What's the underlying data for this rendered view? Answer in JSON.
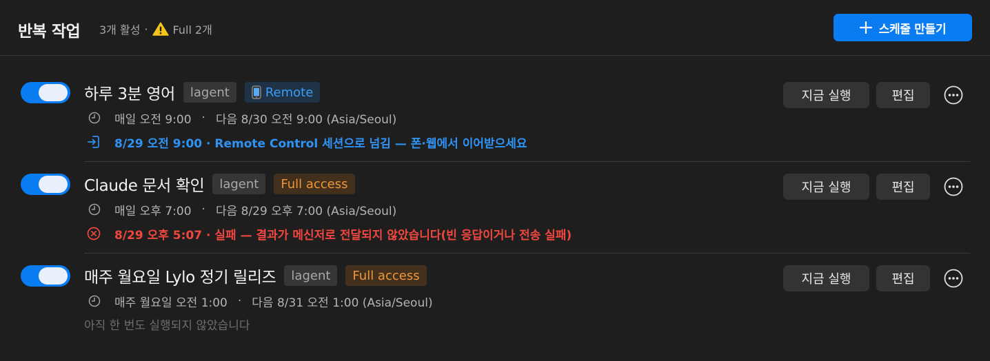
{
  "header": {
    "title": "반복 작업",
    "active_count": "3개 활성",
    "dot": "·",
    "full_count": "Full 2개",
    "create_button": "스케줄 만들기"
  },
  "colors": {
    "accent": "#0a7cf2",
    "info": "#2f93f5",
    "error": "#f0473f",
    "full_access": "#f0963c"
  },
  "tasks": [
    {
      "enabled": true,
      "title": "하루 3분 영어",
      "agent_tag": "lagent",
      "mode_tag": "Remote",
      "mode_icon": "phone-icon",
      "schedule": "매일 오전 9:00",
      "dot": "·",
      "next": "다음 8/30 오전 9:00 (Asia/Seoul)",
      "status": "8/29 오전 9:00 · Remote Control 세션으로 넘김 — 폰·웹에서 이어받으세요",
      "status_type": "info",
      "run_button": "지금 실행",
      "edit_button": "편집"
    },
    {
      "enabled": true,
      "title": "Claude 문서 확인",
      "agent_tag": "lagent",
      "mode_tag": "Full access",
      "schedule": "매일 오후 7:00",
      "dot": "·",
      "next": "다음 8/29 오후 7:00 (Asia/Seoul)",
      "status": "8/29 오후 5:07 · 실패 — 결과가 메신저로 전달되지 않았습니다(빈 응답이거나 전송 실패)",
      "status_type": "error",
      "run_button": "지금 실행",
      "edit_button": "편집"
    },
    {
      "enabled": true,
      "title": "매주 월요일 Lylo 정기 릴리즈",
      "agent_tag": "lagent",
      "mode_tag": "Full access",
      "schedule": "매주 월요일 오전 1:00",
      "dot": "·",
      "next": "다음 8/31 오전 1:00 (Asia/Seoul)",
      "status": "아직 한 번도 실행되지 않았습니다",
      "status_type": "muted",
      "run_button": "지금 실행",
      "edit_button": "편집"
    }
  ]
}
